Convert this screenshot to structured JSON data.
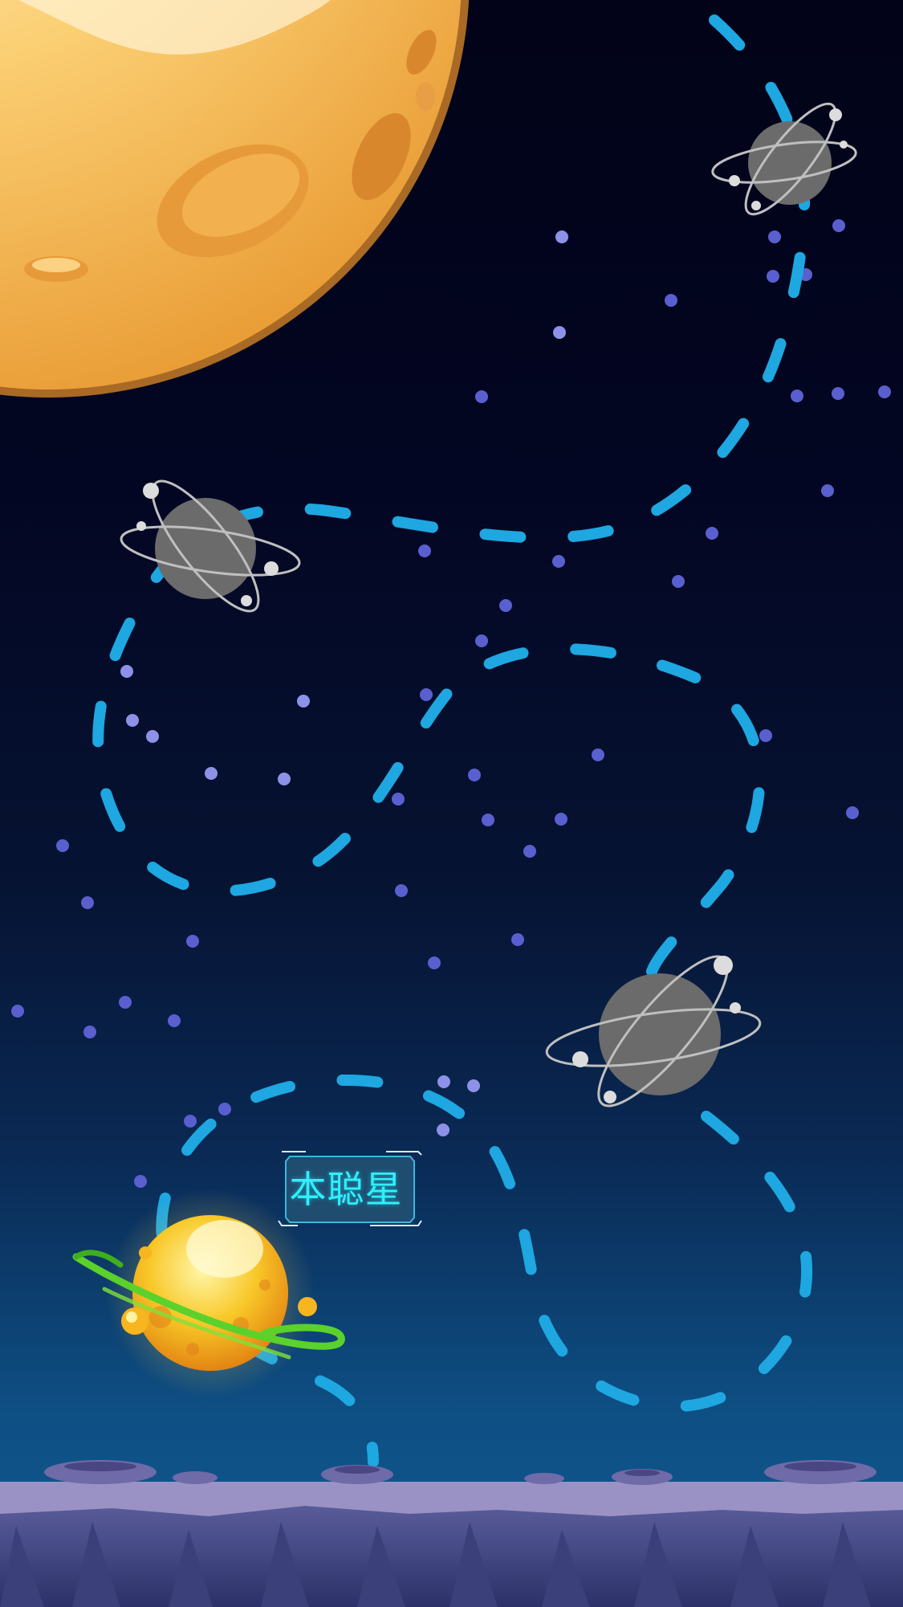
{
  "level_map": {
    "current_planet": {
      "name": "本聪星"
    },
    "locked_planets": [
      {
        "state": "locked",
        "icon": "gray-planet-icon"
      },
      {
        "state": "locked",
        "icon": "gray-planet-icon"
      },
      {
        "state": "locked",
        "icon": "gray-planet-icon"
      }
    ],
    "colors": {
      "path": "#1ea7e1",
      "moon": "#f7be55",
      "label": "#2ef0ff",
      "ground": "#4e5690"
    }
  }
}
